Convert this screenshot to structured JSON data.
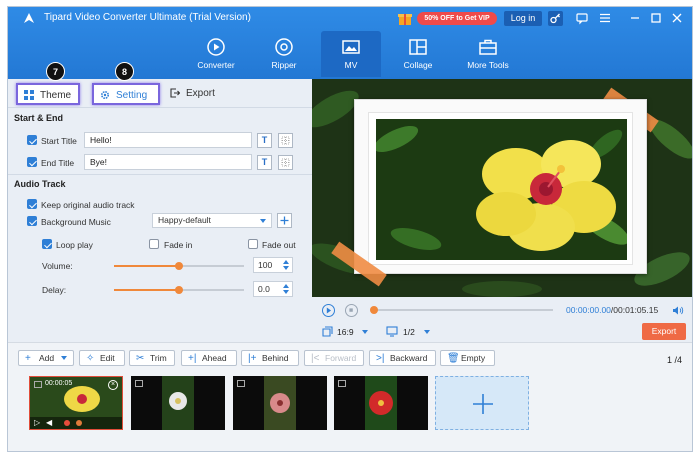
{
  "app": {
    "title": "Tipard Video Converter Ultimate (Trial Version)",
    "vip_label": "50% OFF to Get VIP",
    "login_label": "Log in"
  },
  "nav": {
    "tabs": [
      {
        "label": "Converter",
        "icon": "converter-icon",
        "active": false
      },
      {
        "label": "Ripper",
        "icon": "ripper-icon",
        "active": false
      },
      {
        "label": "MV",
        "icon": "mv-icon",
        "active": true
      },
      {
        "label": "Collage",
        "icon": "collage-icon",
        "active": false
      },
      {
        "label": "More Tools",
        "icon": "toolbox-icon",
        "active": false
      }
    ]
  },
  "panel": {
    "tabs": {
      "theme": "Theme",
      "setting": "Setting",
      "export": "Export"
    },
    "badges": {
      "theme": "7",
      "setting": "8"
    },
    "start_end": {
      "heading": "Start & End",
      "start_title_label": "Start Title",
      "start_title_value": "Hello!",
      "end_title_label": "End Title",
      "end_title_value": "Bye!",
      "text_button": "T"
    },
    "audio": {
      "heading": "Audio Track",
      "keep_original": "Keep original audio track",
      "background_music": "Background Music",
      "music_selected": "Happy-default",
      "loop_play": "Loop play",
      "fade_in": "Fade in",
      "fade_out": "Fade out",
      "volume_label": "Volume:",
      "volume_value": "100",
      "volume_level": 0.5,
      "delay_label": "Delay:",
      "delay_value": "0.0",
      "delay_level": 0.5
    }
  },
  "player": {
    "current_time": "00:00:00.00",
    "total_time": "/00:01:05.15",
    "aspect": "16:9",
    "page_ratio": "1/2",
    "export_label": "Export"
  },
  "toolbar": {
    "add": "Add",
    "edit": "Edit",
    "trim": "Trim",
    "ahead": "Ahead",
    "behind": "Behind",
    "forward": "Forward",
    "backward": "Backward",
    "empty": "Empty",
    "page_current": "1",
    "page_total": "/4"
  },
  "timeline": {
    "selected_clip_time": "00:00:05"
  },
  "colors": {
    "accent": "#2f7fd6",
    "orange": "#f0883a",
    "export": "#ef6a45",
    "vip": "#ef4a4a"
  }
}
